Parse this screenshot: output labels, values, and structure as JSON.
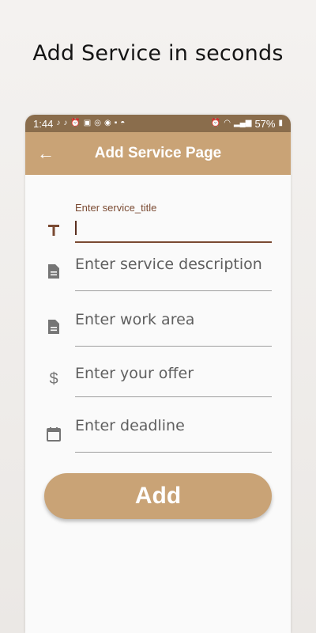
{
  "headline": "Add Service in seconds",
  "status_bar": {
    "time": "1:44",
    "battery": "57%"
  },
  "app_bar": {
    "title": "Add Service Page",
    "back_icon": "arrow-left-icon"
  },
  "form": {
    "fields": [
      {
        "label": "Enter service_title",
        "value": "",
        "icon": "title-icon"
      },
      {
        "placeholder": "Enter service description",
        "icon": "document-icon"
      },
      {
        "placeholder": "Enter work area",
        "icon": "document-icon"
      },
      {
        "placeholder": "Enter your offer",
        "icon": "dollar-icon"
      },
      {
        "placeholder": "Enter deadline",
        "icon": "calendar-icon"
      }
    ],
    "submit_label": "Add"
  },
  "colors": {
    "accent": "#c9a376",
    "status_bar": "#8a6d4c",
    "focus": "#7a4a32"
  }
}
